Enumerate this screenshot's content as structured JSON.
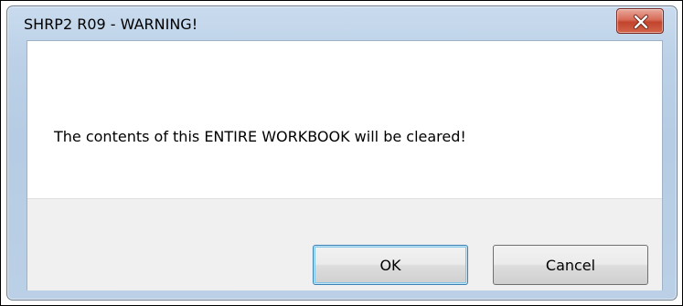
{
  "window": {
    "title": "SHRP2 R09 - WARNING!",
    "close_icon": "close-x-icon"
  },
  "message": {
    "text": "The contents of this ENTIRE WORKBOOK will be cleared!"
  },
  "buttons": {
    "ok_label": "OK",
    "cancel_label": "Cancel"
  },
  "colors": {
    "title_bar": "#bcd1e7",
    "close_button": "#c2442d",
    "client_background": "#ffffff",
    "button_panel": "#f0f0f0"
  }
}
